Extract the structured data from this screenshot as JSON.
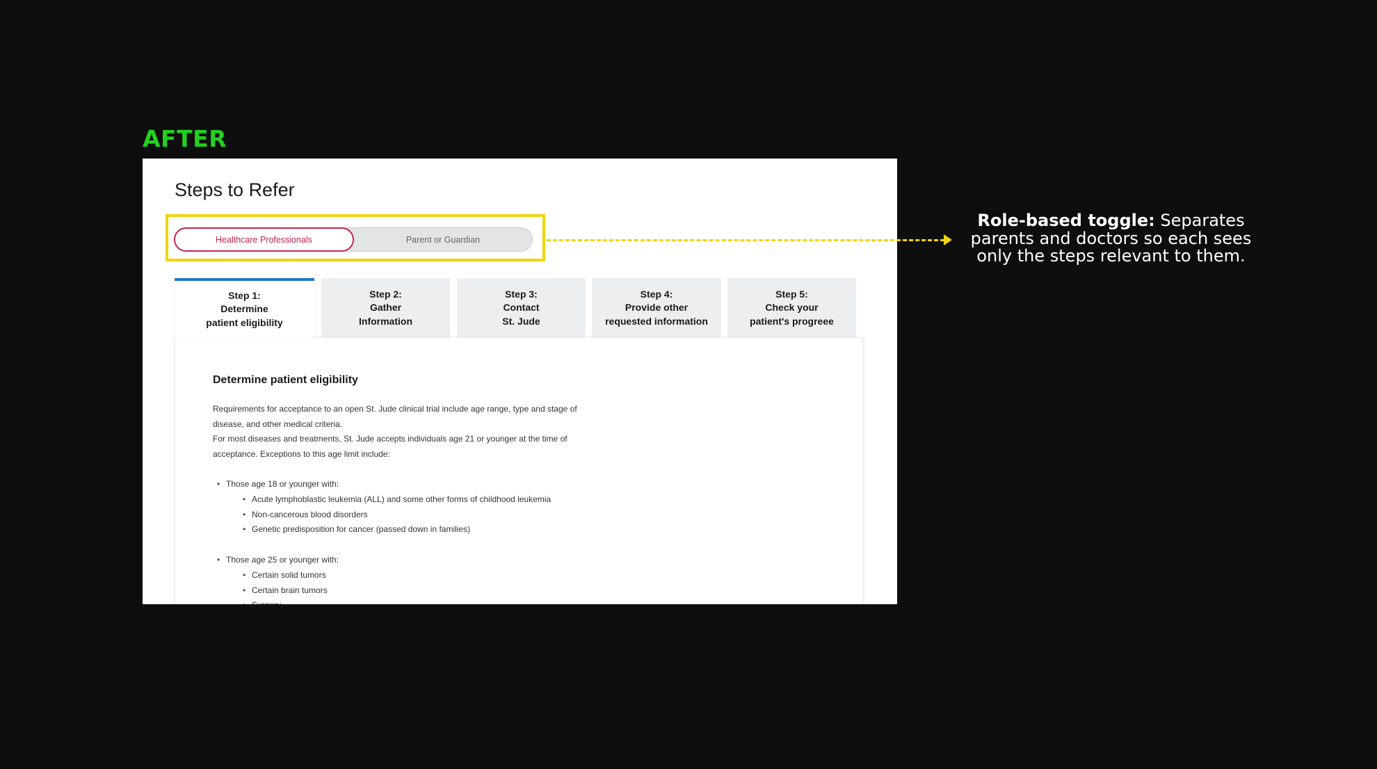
{
  "label": "AFTER",
  "page_title": "Steps to Refer",
  "toggle": {
    "active_label": "Healthcare Professionals",
    "inactive_label": "Parent or Guardian"
  },
  "tabs": [
    {
      "line1": "Step 1:",
      "line2": "Determine",
      "line3": "patient eligibility"
    },
    {
      "line1": "Step 2:",
      "line2": "Gather",
      "line3": "Information"
    },
    {
      "line1": "Step 3:",
      "line2": "Contact",
      "line3": "St. Jude"
    },
    {
      "line1": "Step 4:",
      "line2": "Provide other",
      "line3": "requested information"
    },
    {
      "line1": "Step 5:",
      "line2": "Check your",
      "line3": "patient's progreee"
    }
  ],
  "content": {
    "heading": "Determine patient eligibility",
    "para1": "Requirements for acceptance to an open St. Jude clinical trial include age range, type and stage of disease, and other medical criteria.",
    "para2": "For most diseases and treatments, St. Jude accepts individuals age 21 or younger at the time of acceptance. Exceptions to this age limit include:",
    "group1": {
      "label": "Those age 18 or younger with:",
      "items": [
        "Acute lymphoblastic leukemia (ALL) and some other forms of childhood leukemia",
        "Non-cancerous blood disorders",
        "Genetic predisposition for cancer (passed down in families)"
      ]
    },
    "group2": {
      "label": "Those age 25 or younger with:",
      "items": [
        "Certain solid tumors",
        "Certain brain tumors",
        "Surgery"
      ]
    }
  },
  "annotation": {
    "bold": "Role-based toggle:",
    "text": " Separates parents and doctors so each sees only the steps relevant to them."
  },
  "colors": {
    "after_label": "#22d11f",
    "highlight": "#f2d410",
    "toggle_active": "#c4264e",
    "active_tab_border": "#1f7ac9"
  }
}
